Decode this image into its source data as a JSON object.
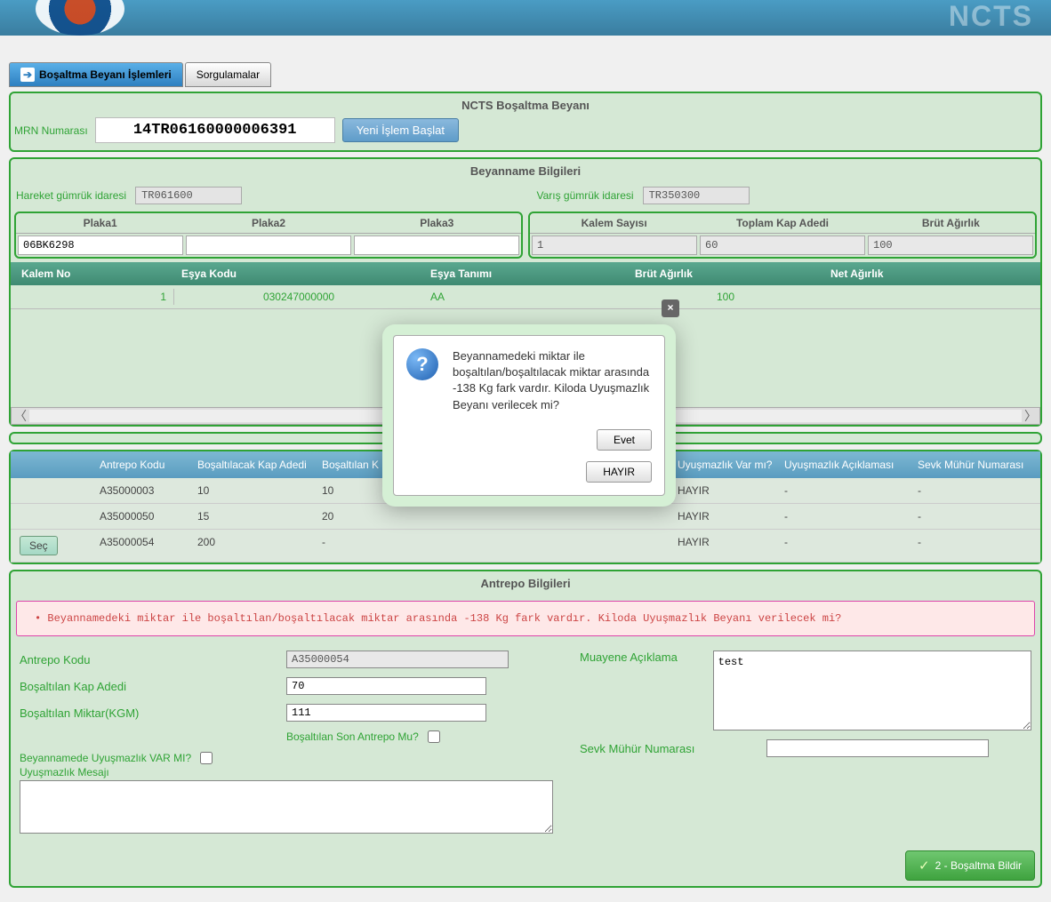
{
  "brand": "NCTS",
  "tabs": {
    "active": "Boşaltma Beyanı İşlemleri",
    "second": "Sorgulamalar"
  },
  "panel1": {
    "title": "NCTS Boşaltma Beyanı",
    "mrn_label": "MRN Numarası",
    "mrn_value": "14TR06160000006391",
    "yeni_btn": "Yeni İşlem Başlat"
  },
  "panel2": {
    "title": "Beyanname Bilgileri",
    "hareket_label": "Hareket gümrük idaresi",
    "hareket_val": "TR061600",
    "varis_label": "Varış gümrük idaresi",
    "varis_val": "TR350300",
    "plaka1_h": "Plaka1",
    "plaka2_h": "Plaka2",
    "plaka3_h": "Plaka3",
    "plaka1_v": "06BK6298",
    "plaka2_v": "",
    "plaka3_v": "",
    "kalem_h": "Kalem Sayısı",
    "kap_h": "Toplam Kap Adedi",
    "brut_h": "Brüt Ağırlık",
    "kalem_v": "1",
    "kap_v": "60",
    "brut_v": "100",
    "cols": {
      "kalemno": "Kalem No",
      "esyakodu": "Eşya Kodu",
      "esyatanimi": "Eşya Tanımı",
      "brutag": "Brüt Ağırlık",
      "netag": "Net Ağırlık"
    },
    "row": {
      "kalemno": "1",
      "esyakodu": "030247000000",
      "esyatanimi": "AA",
      "brutag": "100",
      "netag": ""
    }
  },
  "antrepo_table": {
    "h": {
      "kod": "Antrepo Kodu",
      "bkap": "Boşaltılacak Kap Adedi",
      "btkap": "Boşaltılan K",
      "uyus": "Uyuşmazlık Var mı?",
      "acik": "Uyuşmazlık Açıklaması",
      "sevk": "Sevk Mühür Numarası"
    },
    "rows": [
      {
        "sec": "",
        "kod": "A35000003",
        "bkap": "10",
        "btkap": "10",
        "uyus": "HAYIR",
        "acik": "-",
        "sevk": "-"
      },
      {
        "sec": "",
        "kod": "A35000050",
        "bkap": "15",
        "btkap": "20",
        "uyus": "HAYIR",
        "acik": "-",
        "sevk": "-"
      },
      {
        "sec": "Seç",
        "kod": "A35000054",
        "bkap": "200",
        "btkap": "-",
        "uyus": "HAYIR",
        "acik": "-",
        "sevk": "-"
      }
    ]
  },
  "antrepo_panel": {
    "title": "Antrepo Bilgileri",
    "warning": "Beyannamedeki miktar ile boşaltılan/boşaltılacak miktar arasında -138 Kg fark vardır. Kiloda Uyuşmazlık Beyanı verilecek mi?",
    "kod_l": "Antrepo Kodu",
    "kod_v": "A35000054",
    "btkap_l": "Boşaltılan Kap Adedi",
    "btkap_v": "70",
    "btmiktar_l": "Boşaltılan Miktar(KGM)",
    "btmiktar_v": "111",
    "son_l": "Boşaltılan Son Antrepo Mu?",
    "uyus_l": "Beyannamede Uyuşmazlık VAR MI?",
    "uyusmsg_l": "Uyuşmazlık Mesajı",
    "muayene_l": "Muayene Açıklama",
    "muayene_v": "test",
    "sevk_l": "Sevk Mühür Numarası",
    "action_btn": "2 - Boşaltma Bildir"
  },
  "dialog": {
    "text": "Beyannamedeki miktar ile boşaltılan/boşaltılacak miktar arasında -138 Kg fark vardır. Kiloda Uyuşmazlık Beyanı verilecek mi?",
    "evet": "Evet",
    "hayir": "HAYIR",
    "close": "×"
  }
}
